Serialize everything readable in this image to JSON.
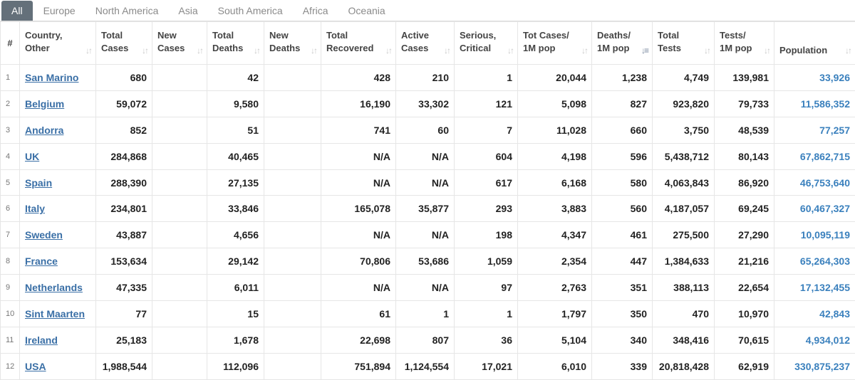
{
  "tabs": [
    {
      "label": "All",
      "active": true
    },
    {
      "label": "Europe",
      "active": false
    },
    {
      "label": "North America",
      "active": false
    },
    {
      "label": "Asia",
      "active": false
    },
    {
      "label": "South America",
      "active": false
    },
    {
      "label": "Africa",
      "active": false
    },
    {
      "label": "Oceania",
      "active": false
    }
  ],
  "columns": [
    {
      "l1": "#",
      "l2": "",
      "sortable": false
    },
    {
      "l1": "Country,",
      "l2": "Other",
      "sortable": true
    },
    {
      "l1": "Total",
      "l2": "Cases",
      "sortable": true
    },
    {
      "l1": "New",
      "l2": "Cases",
      "sortable": true
    },
    {
      "l1": "Total",
      "l2": "Deaths",
      "sortable": true
    },
    {
      "l1": "New",
      "l2": "Deaths",
      "sortable": true
    },
    {
      "l1": "Total",
      "l2": "Recovered",
      "sortable": true
    },
    {
      "l1": "Active",
      "l2": "Cases",
      "sortable": true
    },
    {
      "l1": "Serious,",
      "l2": "Critical",
      "sortable": true
    },
    {
      "l1": "Tot Cases/",
      "l2": "1M pop",
      "sortable": true
    },
    {
      "l1": "Deaths/",
      "l2": "1M pop",
      "sortable": true,
      "active_sort": true
    },
    {
      "l1": "Total",
      "l2": "Tests",
      "sortable": true
    },
    {
      "l1": "Tests/",
      "l2": "1M pop",
      "sortable": true
    },
    {
      "l1": "Population",
      "l2": "",
      "sortable": true
    }
  ],
  "rows": [
    [
      "1",
      "San Marino",
      "680",
      "",
      "42",
      "",
      "428",
      "210",
      "1",
      "20,044",
      "1,238",
      "4,749",
      "139,981",
      "33,926"
    ],
    [
      "2",
      "Belgium",
      "59,072",
      "",
      "9,580",
      "",
      "16,190",
      "33,302",
      "121",
      "5,098",
      "827",
      "923,820",
      "79,733",
      "11,586,352"
    ],
    [
      "3",
      "Andorra",
      "852",
      "",
      "51",
      "",
      "741",
      "60",
      "7",
      "11,028",
      "660",
      "3,750",
      "48,539",
      "77,257"
    ],
    [
      "4",
      "UK",
      "284,868",
      "",
      "40,465",
      "",
      "N/A",
      "N/A",
      "604",
      "4,198",
      "596",
      "5,438,712",
      "80,143",
      "67,862,715"
    ],
    [
      "5",
      "Spain",
      "288,390",
      "",
      "27,135",
      "",
      "N/A",
      "N/A",
      "617",
      "6,168",
      "580",
      "4,063,843",
      "86,920",
      "46,753,640"
    ],
    [
      "6",
      "Italy",
      "234,801",
      "",
      "33,846",
      "",
      "165,078",
      "35,877",
      "293",
      "3,883",
      "560",
      "4,187,057",
      "69,245",
      "60,467,327"
    ],
    [
      "7",
      "Sweden",
      "43,887",
      "",
      "4,656",
      "",
      "N/A",
      "N/A",
      "198",
      "4,347",
      "461",
      "275,500",
      "27,290",
      "10,095,119"
    ],
    [
      "8",
      "France",
      "153,634",
      "",
      "29,142",
      "",
      "70,806",
      "53,686",
      "1,059",
      "2,354",
      "447",
      "1,384,633",
      "21,216",
      "65,264,303"
    ],
    [
      "9",
      "Netherlands",
      "47,335",
      "",
      "6,011",
      "",
      "N/A",
      "N/A",
      "97",
      "2,763",
      "351",
      "388,113",
      "22,654",
      "17,132,455"
    ],
    [
      "10",
      "Sint Maarten",
      "77",
      "",
      "15",
      "",
      "61",
      "1",
      "1",
      "1,797",
      "350",
      "470",
      "10,970",
      "42,843"
    ],
    [
      "11",
      "Ireland",
      "25,183",
      "",
      "1,678",
      "",
      "22,698",
      "807",
      "36",
      "5,104",
      "340",
      "348,416",
      "70,615",
      "4,934,012"
    ],
    [
      "12",
      "USA",
      "1,988,544",
      "",
      "112,096",
      "",
      "751,894",
      "1,124,554",
      "17,021",
      "6,010",
      "339",
      "20,818,428",
      "62,919",
      "330,875,237"
    ]
  ],
  "colors": {
    "active_tab": "#64707a",
    "link": "#3a6fa6",
    "population": "#3a80bd"
  },
  "icons": {
    "sort": "sort-icon",
    "sort_active": "sort-desc-icon"
  }
}
